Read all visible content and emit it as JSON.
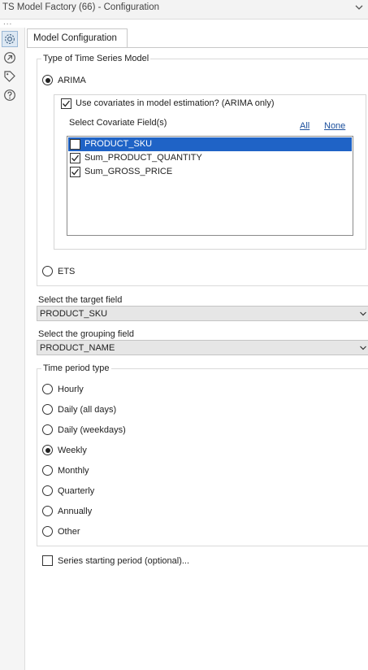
{
  "window": {
    "title": "TS Model Factory (66) - Configuration",
    "overflow_dots": "..."
  },
  "sidebar": {
    "icons": [
      {
        "name": "settings-gear-icon",
        "active": true
      },
      {
        "name": "navigate-arrow-icon",
        "active": false
      },
      {
        "name": "tag-icon",
        "active": false
      },
      {
        "name": "help-icon",
        "active": false
      }
    ]
  },
  "tab": {
    "label": "Model Configuration"
  },
  "model_type": {
    "title": "Type of Time Series Model",
    "arima_label": "ARIMA",
    "ets_label": "ETS",
    "selected": "ARIMA",
    "use_covariates_label": "Use covariates in model estimation? (ARIMA only)",
    "use_covariates_checked": true,
    "covariate_header": "Select Covariate Field(s)",
    "all_link": "All",
    "none_link": "None",
    "fields": [
      {
        "label": "PRODUCT_SKU",
        "checked": false,
        "selected": true
      },
      {
        "label": "Sum_PRODUCT_QUANTITY",
        "checked": true,
        "selected": false
      },
      {
        "label": "Sum_GROSS_PRICE",
        "checked": true,
        "selected": false
      }
    ]
  },
  "target_field": {
    "label": "Select the target field",
    "value": "PRODUCT_SKU"
  },
  "grouping_field": {
    "label": "Select the grouping field",
    "value": "PRODUCT_NAME"
  },
  "time_period": {
    "title": "Time period type",
    "selected": "Weekly",
    "options": [
      "Hourly",
      "Daily (all days)",
      "Daily (weekdays)",
      "Weekly",
      "Monthly",
      "Quarterly",
      "Annually",
      "Other"
    ]
  },
  "series_start": {
    "label": "Series starting period (optional)...",
    "checked": false
  },
  "colors": {
    "selection": "#1f63c6",
    "link": "#1b4f9c",
    "active_icon_bg": "#dde8f3"
  }
}
